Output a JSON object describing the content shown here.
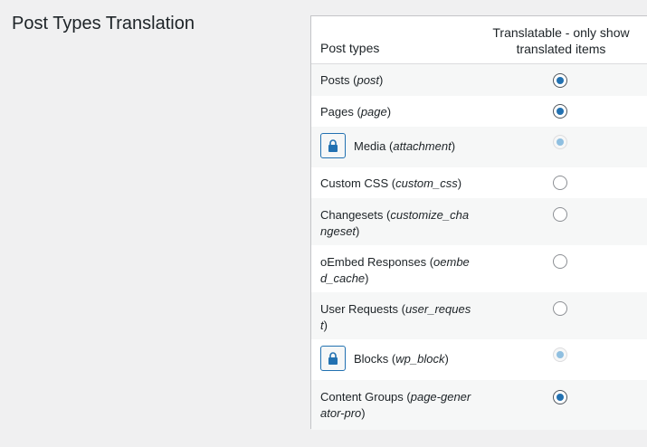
{
  "page": {
    "title": "Post Types Translation"
  },
  "table": {
    "headers": {
      "post_types": "Post types",
      "translatable": "Translatable - only show translated items"
    },
    "rows": [
      {
        "name": "Posts",
        "slug": "post",
        "checked": true,
        "locked": false
      },
      {
        "name": "Pages",
        "slug": "page",
        "checked": true,
        "locked": false
      },
      {
        "name": "Media",
        "slug": "attachment",
        "checked": true,
        "locked": true
      },
      {
        "name": "Custom CSS",
        "slug": "custom_css",
        "checked": false,
        "locked": false
      },
      {
        "name": "Changesets",
        "slug": "customize_changeset",
        "checked": false,
        "locked": false
      },
      {
        "name": "oEmbed Responses",
        "slug": "oembed_cache",
        "checked": false,
        "locked": false
      },
      {
        "name": "User Requests",
        "slug": "user_request",
        "checked": false,
        "locked": false
      },
      {
        "name": "Blocks",
        "slug": "wp_block",
        "checked": true,
        "locked": true
      },
      {
        "name": "Content Groups",
        "slug": "page-generator-pro",
        "checked": true,
        "locked": false
      }
    ]
  },
  "icons": {
    "lock": "lock-icon"
  },
  "colors": {
    "accent": "#2271b1",
    "text": "#1d2327",
    "background": "#f0f0f1"
  }
}
